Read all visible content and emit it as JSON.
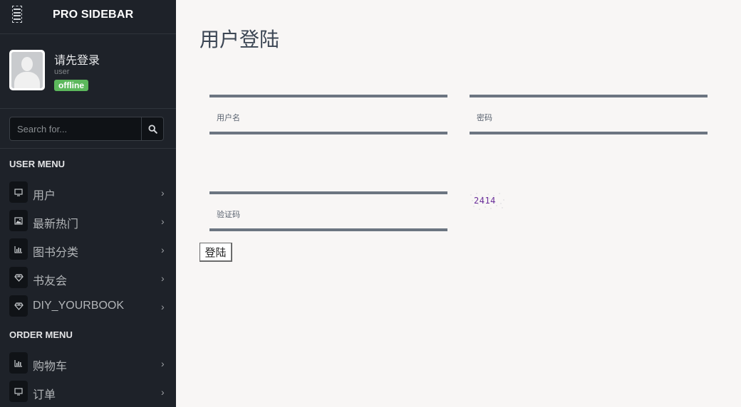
{
  "sidebar": {
    "brand": "PRO SIDEBAR",
    "user": {
      "name": "请先登录",
      "role": "user",
      "status": "offline",
      "status_color": "#5cb85c"
    },
    "search": {
      "placeholder": "Search for..."
    },
    "user_menu": {
      "header": "USER MENU",
      "items": [
        {
          "label": "用户",
          "icon": "monitor-icon"
        },
        {
          "label": "最新热门",
          "icon": "image-icon"
        },
        {
          "label": "图书分类",
          "icon": "bar-chart-icon"
        },
        {
          "label": "书友会",
          "icon": "diamond-icon"
        },
        {
          "label": "DIY_YOURBOOK",
          "icon": "diamond-icon"
        }
      ]
    },
    "order_menu": {
      "header": "ORDER MENU",
      "items": [
        {
          "label": "购物车",
          "icon": "bar-chart-icon"
        },
        {
          "label": "订单",
          "icon": "monitor-icon"
        }
      ]
    }
  },
  "main": {
    "title": "用户登陆",
    "fields": {
      "username_label": "用户名",
      "password_label": "密码",
      "captcha_label": "验证码"
    },
    "captcha_text": "2414",
    "login_label": "登陆"
  },
  "colors": {
    "sidebar_bg": "#1e2229",
    "main_bg": "#f8f6f5",
    "field_border": "#6c7581"
  }
}
